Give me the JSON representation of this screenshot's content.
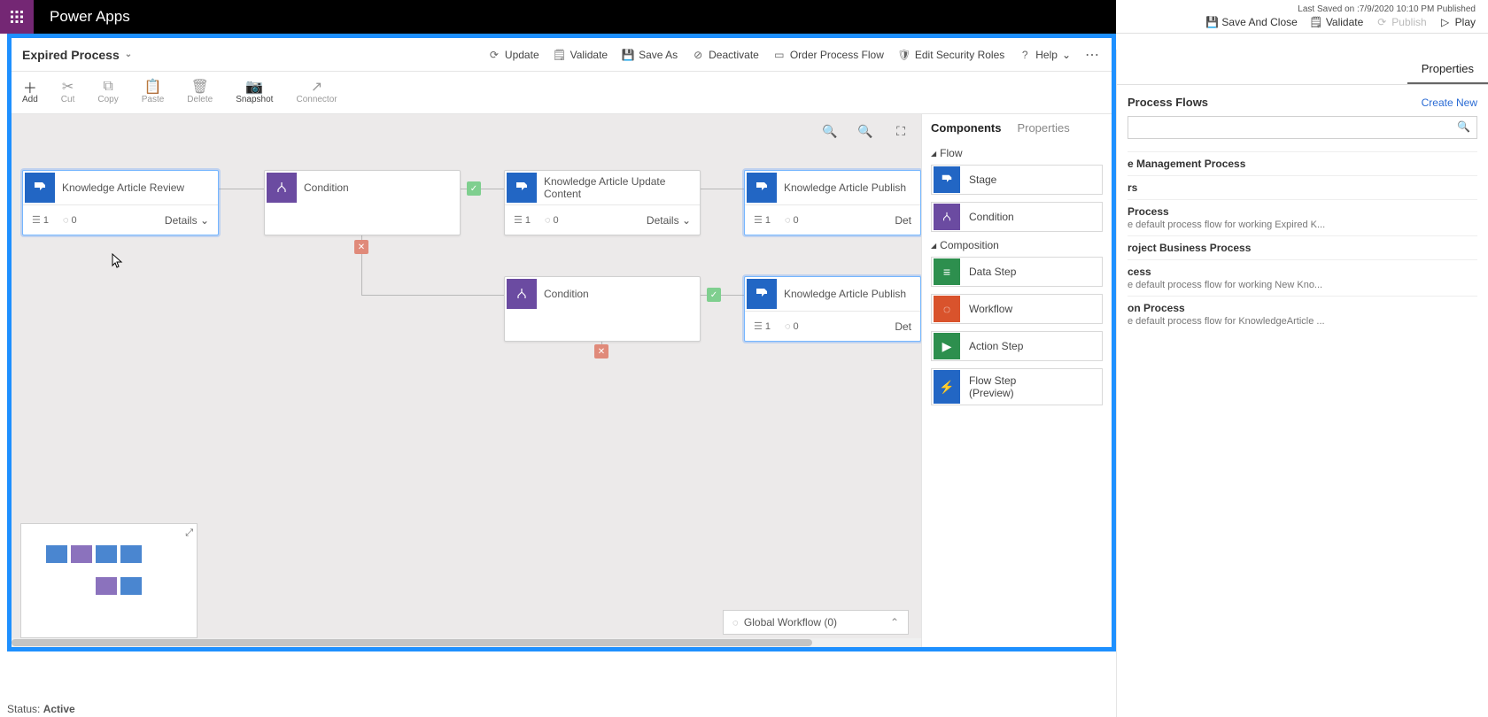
{
  "app": {
    "title": "Power Apps"
  },
  "top_actions": {
    "last_saved": "Last Saved on :7/9/2020 10:10 PM Published",
    "save_close": "Save And Close",
    "validate": "Validate",
    "publish": "Publish",
    "play": "Play"
  },
  "process": {
    "name": "Expired Process"
  },
  "header_cmds": {
    "update": "Update",
    "validate": "Validate",
    "save_as": "Save As",
    "deactivate": "Deactivate",
    "order": "Order Process Flow",
    "security": "Edit Security Roles",
    "help": "Help"
  },
  "toolbar": {
    "add": "Add",
    "cut": "Cut",
    "copy": "Copy",
    "paste": "Paste",
    "delete": "Delete",
    "snapshot": "Snapshot",
    "connector": "Connector"
  },
  "stages": {
    "s1": {
      "title": "Knowledge Article Review",
      "steps": "1",
      "dur": "0",
      "details": "Details"
    },
    "s2": {
      "title": "Condition"
    },
    "s3": {
      "title": "Knowledge Article Update Content",
      "steps": "1",
      "dur": "0",
      "details": "Details"
    },
    "s4": {
      "title": "Knowledge Article Publish",
      "steps": "1",
      "dur": "0",
      "details": "Det"
    },
    "s5": {
      "title": "Condition"
    },
    "s6": {
      "title": "Knowledge Article Publish",
      "steps": "1",
      "dur": "0",
      "details": "Det"
    }
  },
  "components": {
    "tab_components": "Components",
    "tab_properties": "Properties",
    "flow_h": "Flow",
    "stage": "Stage",
    "condition": "Condition",
    "comp_h": "Composition",
    "data_step": "Data Step",
    "workflow": "Workflow",
    "action_step": "Action Step",
    "flow_step": "Flow Step",
    "flow_step_sub": "(Preview)"
  },
  "global_wf": "Global Workflow (0)",
  "right_panel": {
    "tab_properties": "Properties",
    "section": "Process Flows",
    "create_new": "Create New",
    "items": [
      {
        "name": "e Management Process",
        "desc": ""
      },
      {
        "name": "rs",
        "desc": ""
      },
      {
        "name": "Process",
        "desc": "e default process flow for working Expired K..."
      },
      {
        "name": "roject Business Process",
        "desc": ""
      },
      {
        "name": "cess",
        "desc": "e default process flow for working New Kno..."
      },
      {
        "name": "on Process",
        "desc": "e default process flow for KnowledgeArticle ..."
      }
    ]
  },
  "status": {
    "label": "Status:",
    "value": "Active"
  }
}
